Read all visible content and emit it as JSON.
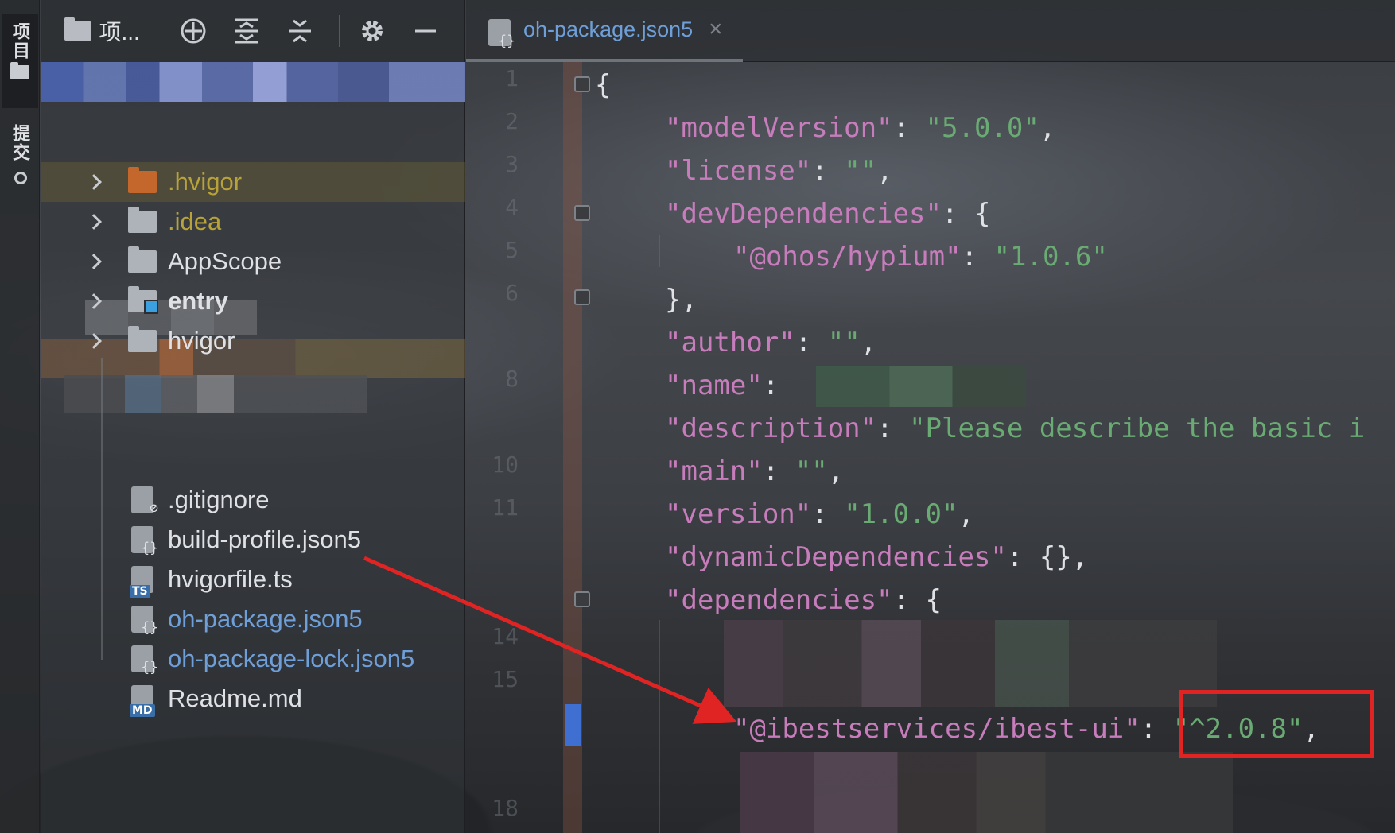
{
  "strip": {
    "project_label": "项目",
    "commit_label": "提交"
  },
  "panel": {
    "title": "项...",
    "icons": [
      "target-icon",
      "expand-all-icon",
      "collapse-all-icon",
      "gear-icon",
      "minimize-icon"
    ]
  },
  "tree": {
    "items": [
      {
        "label": ".hvigor",
        "kind": "folder",
        "color": "orange"
      },
      {
        "label": ".idea",
        "kind": "folder"
      },
      {
        "label": "AppScope",
        "kind": "folder"
      },
      {
        "label": "entry",
        "kind": "module"
      },
      {
        "label": "hvigor",
        "kind": "folder"
      },
      {
        "label": ".gitignore",
        "kind": "file"
      },
      {
        "label": "build-profile.json5",
        "kind": "json"
      },
      {
        "label": "hvigorfile.ts",
        "kind": "ts",
        "badge": "TS"
      },
      {
        "label": "oh-package.json5",
        "kind": "json"
      },
      {
        "label": "oh-package-lock.json5",
        "kind": "json"
      },
      {
        "label": "Readme.md",
        "kind": "md",
        "badge": "MD"
      }
    ]
  },
  "editor": {
    "tab_label": "oh-package.json5",
    "tab_close": "×",
    "line_numbers": [
      "1",
      "2",
      "3",
      "4",
      "5",
      "6",
      "8",
      "10",
      "11",
      "14",
      "15",
      "18"
    ],
    "lines": {
      "l1": "{",
      "l2_key": "\"modelVersion\"",
      "l2_val": "\"5.0.0\"",
      "l3_key": "\"license\"",
      "l3_val": "\"\"",
      "l4_key": "\"devDependencies\"",
      "l4_tail": ": {",
      "l5_key": "\"@ohos/hypium\"",
      "l5_val": "\"1.0.6\"",
      "l6": "},",
      "l7_key": "\"author\"",
      "l7_val": "\"\"",
      "l8_key": "\"name\"",
      "l9_key": "\"description\"",
      "l9_val": "\"Please describe the basic i",
      "l10_key": "\"main\"",
      "l10_val": "\"\"",
      "l11_key": "\"version\"",
      "l11_val": "\"1.0.0\"",
      "l12_key": "\"dynamicDependencies\"",
      "l12_tail": ": {},",
      "l13_key": "\"dependencies\"",
      "l13_tail": ": {",
      "l16_key": "\"@ibestservices/ibest-ui\"",
      "l16_val": "\"^2.0.8\""
    }
  },
  "colors": {
    "annotation_red": "#e02424",
    "json_key": "#c77dbb",
    "json_string": "#6aab73"
  }
}
